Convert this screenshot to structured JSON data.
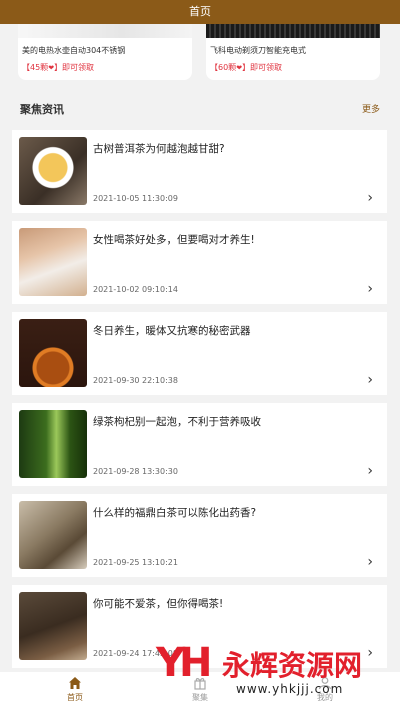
{
  "topbar": {
    "title": "首页"
  },
  "products": [
    {
      "title": "美的电热水壶自动304不锈钢",
      "price": "【45颗",
      "heart": "❤",
      "price_suffix": "】即可领取"
    },
    {
      "title": "飞科电动剃须刀智能充电式",
      "price": "【60颗",
      "heart": "❤",
      "price_suffix": "】即可领取"
    }
  ],
  "section": {
    "title": "聚焦资讯",
    "more": "更多"
  },
  "articles": [
    {
      "title": "古树普洱茶为何越泡越甘甜?",
      "date": "2021-10-05 11:30:09"
    },
    {
      "title": "女性喝茶好处多，但要喝对才养生!",
      "date": "2021-10-02 09:10:14"
    },
    {
      "title": "冬日养生，暖体又抗寒的秘密武器",
      "date": "2021-09-30 22:10:38"
    },
    {
      "title": "绿茶枸杞别一起泡，不利于营养吸收",
      "date": "2021-09-28 13:30:30"
    },
    {
      "title": "什么样的福鼎白茶可以陈化出药香?",
      "date": "2021-09-25 13:10:21"
    },
    {
      "title": "你可能不爱茶，但你得喝茶!",
      "date": "2021-09-24 17:45:08"
    }
  ],
  "tabbar": [
    {
      "label": "首页",
      "icon": "home-icon"
    },
    {
      "label": "聚集",
      "icon": "gift-icon"
    },
    {
      "label": "我的",
      "icon": "user-icon"
    }
  ],
  "watermark": {
    "logo": "YH",
    "text": "永辉资源网",
    "url": "www.yhkjjj.com"
  },
  "colors": {
    "brand": "#8b5a18",
    "price": "#e0333f",
    "watermark": "#e2202c"
  }
}
